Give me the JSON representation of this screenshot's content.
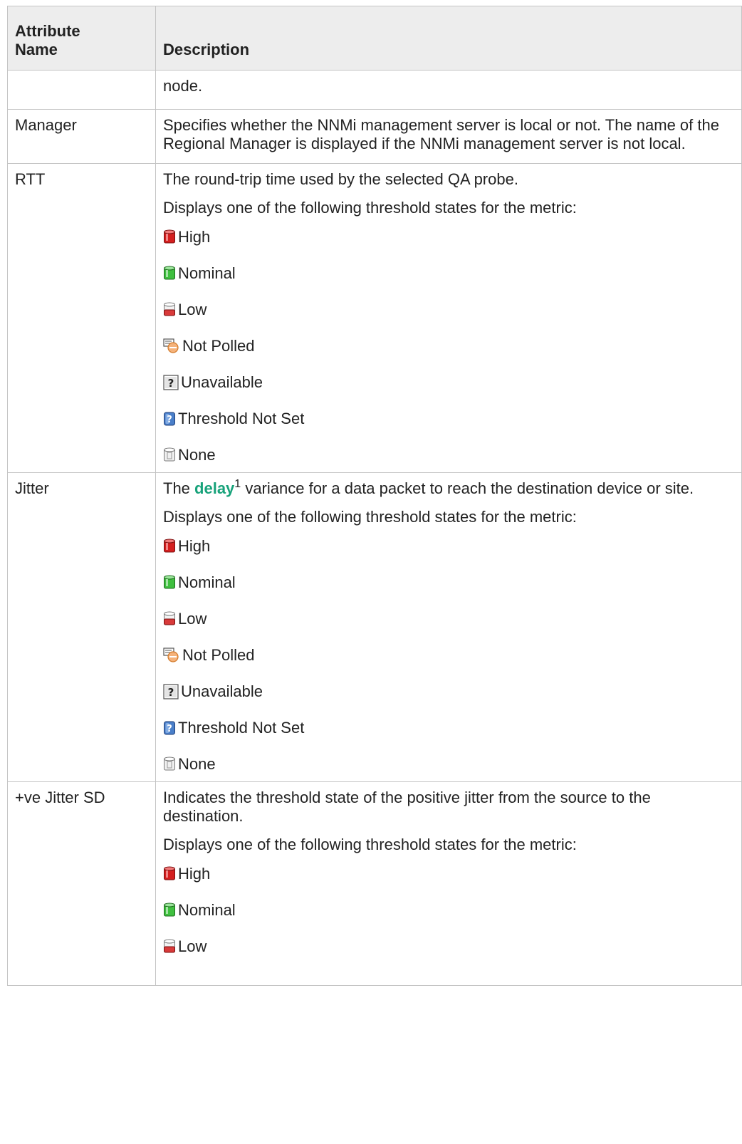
{
  "table": {
    "headers": [
      "Attribute Name",
      "Description"
    ],
    "header_attr_line1": "Attribute",
    "header_attr_line2": "Name",
    "header_desc": "Description"
  },
  "rows": {
    "node": {
      "name": "",
      "text": "node."
    },
    "manager": {
      "name": "Manager",
      "text": "Specifies whether the NNMi management server is local or not. The name of the Regional Manager is displayed if the NNMi management server is not local."
    },
    "rtt": {
      "name": "RTT",
      "text": "The round-trip time used by the selected QA probe."
    },
    "jitter": {
      "name": "Jitter",
      "text_before": "The ",
      "link": "delay",
      "footnote": "1",
      "text_after": " variance for a data packet to reach the destination device or site."
    },
    "jitter_sd": {
      "name": "+ve Jitter SD",
      "text": "Indicates the threshold state of the positive jitter from the source to the destination."
    }
  },
  "displays_text": "Displays one of the following threshold states for the metric:",
  "states": {
    "high": "High",
    "nominal": "Nominal",
    "low": "Low",
    "not_polled": "Not Polled",
    "unavailable": "Unavailable",
    "not_set": "Threshold Not Set",
    "none": "None"
  },
  "icons": {
    "high": "red-cylinder-icon",
    "nominal": "green-cylinder-icon",
    "low": "low-cylinder-icon",
    "not_polled": "not-polled-icon",
    "unavailable": "question-box-icon",
    "not_set": "blue-question-icon",
    "none": "empty-cylinder-icon"
  },
  "colors": {
    "link": "#17a27a",
    "header_bg": "#ededed",
    "border": "#c4c4c4"
  }
}
